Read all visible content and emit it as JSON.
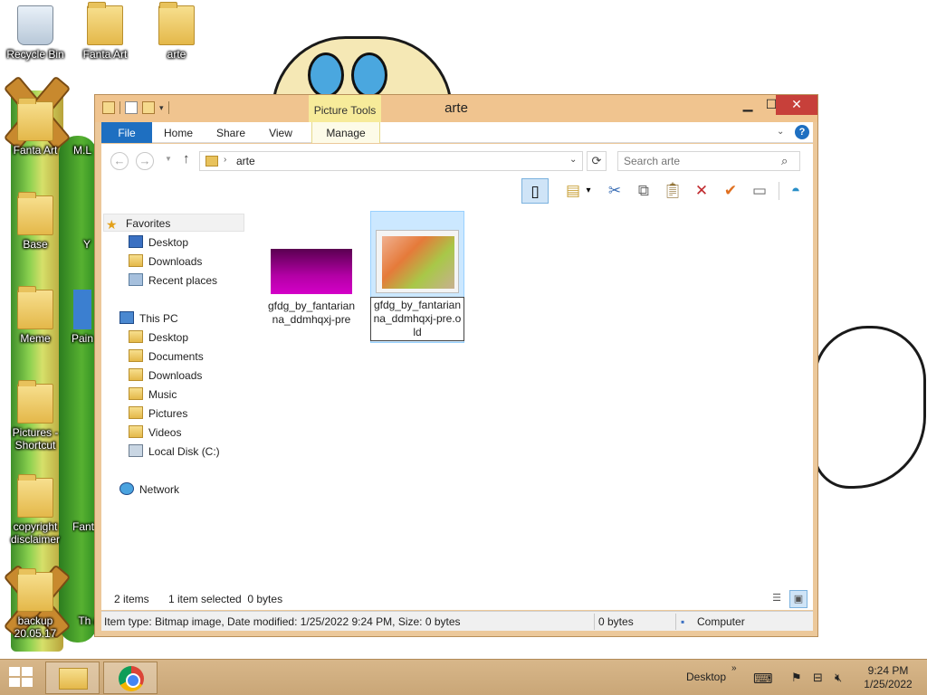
{
  "desktop": {
    "icons": [
      {
        "label": "Recycle Bin",
        "icon": "recycle-bin-icon"
      },
      {
        "label": "Fanta Art",
        "icon": "folder-icon"
      },
      {
        "label": "arte",
        "icon": "folder-icon"
      },
      {
        "label": "Fanta Art",
        "icon": "folder-icon"
      },
      {
        "label": "M.L",
        "icon": "folder-icon"
      },
      {
        "label": "Base",
        "icon": "folder-icon"
      },
      {
        "label": "Y",
        "icon": "folder-icon"
      },
      {
        "label": "Meme",
        "icon": "folder-icon"
      },
      {
        "label": "Pain",
        "icon": "paint-icon"
      },
      {
        "label": "Pictures - Shortcut",
        "icon": "shortcut-icon"
      },
      {
        "label": "copyright disclaimer",
        "icon": "folder-icon"
      },
      {
        "label": "Fant",
        "icon": "folder-icon"
      },
      {
        "label": "backup 20.05.17",
        "icon": "folder-icon"
      },
      {
        "label": "Th artist",
        "icon": "folder-icon"
      }
    ]
  },
  "window": {
    "title": "arte",
    "picture_tools_label": "Picture Tools",
    "ribbon_tabs": {
      "file": "File",
      "home": "Home",
      "share": "Share",
      "view": "View",
      "manage": "Manage"
    },
    "address": {
      "path": "arte"
    },
    "search": {
      "placeholder": "Search arte"
    },
    "nav_pane": {
      "favorites": {
        "label": "Favorites",
        "items": [
          "Desktop",
          "Downloads",
          "Recent places"
        ]
      },
      "this_pc": {
        "label": "This PC",
        "items": [
          "Desktop",
          "Documents",
          "Downloads",
          "Music",
          "Pictures",
          "Videos",
          "Local Disk (C:)"
        ]
      },
      "network": {
        "label": "Network"
      }
    },
    "files": [
      {
        "name": "gfdg_by_fantarianna_ddmhqxj-pre",
        "selected": false
      },
      {
        "name": "gfdg_by_fantarianna_ddmhqxj-pre.old",
        "selected": true
      }
    ],
    "items_bar": {
      "count": "2 items",
      "selected": "1 item selected  0 bytes"
    },
    "status_bar": {
      "info": "Item type: Bitmap image, Date modified: 1/25/2022 9:24 PM, Size: 0 bytes",
      "size": "0 bytes",
      "location": "Computer"
    }
  },
  "taskbar": {
    "desktop_label": "Desktop",
    "time": "9:24 PM",
    "date": "1/25/2022"
  }
}
